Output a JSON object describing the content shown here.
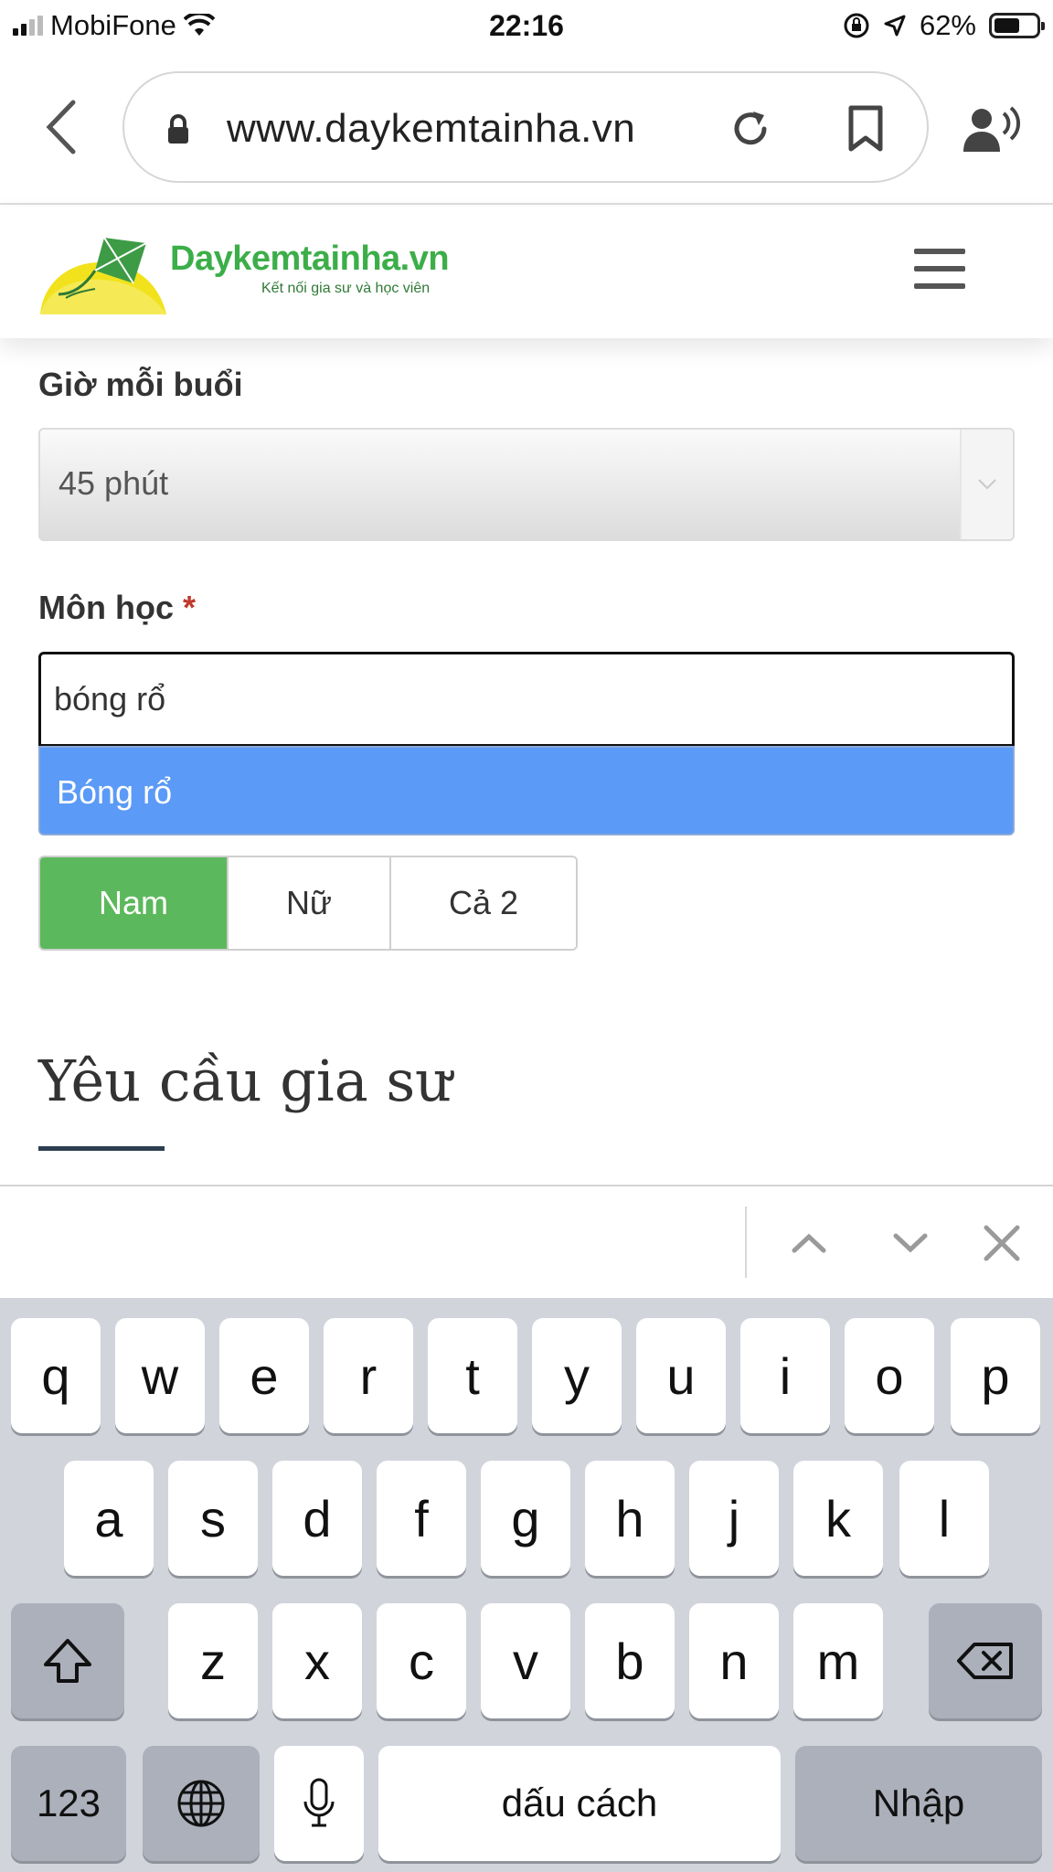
{
  "status_bar": {
    "carrier": "MobiFone",
    "time": "22:16",
    "battery": "62%",
    "battery_level": 0.62
  },
  "browser": {
    "url": "www.daykemtainha.vn"
  },
  "site": {
    "logo_name": "Daykemtainha.vn",
    "logo_tagline": "Kết nối gia sư và học viên"
  },
  "form": {
    "duration_label": "Giờ mỗi buổi",
    "duration_value": "45 phút",
    "subject_label": "Môn học",
    "subject_required_mark": "*",
    "subject_value": "bóng rổ",
    "subject_suggestion": "Bóng rổ",
    "gender_options": [
      "Nam",
      "Nữ",
      "Cả 2"
    ],
    "gender_selected": "Nam"
  },
  "section": {
    "title": "Yêu cầu gia sư"
  },
  "keyboard": {
    "row1": [
      "q",
      "w",
      "e",
      "r",
      "t",
      "y",
      "u",
      "i",
      "o",
      "p"
    ],
    "row2": [
      "a",
      "s",
      "d",
      "f",
      "g",
      "h",
      "j",
      "k",
      "l"
    ],
    "row3": [
      "z",
      "x",
      "c",
      "v",
      "b",
      "n",
      "m"
    ],
    "numbers_label": "123",
    "space_label": "dấu cách",
    "return_label": "Nhập"
  },
  "colors": {
    "brand_green": "#3cae49",
    "selected_green": "#5cb85c",
    "suggestion_blue": "#5b9af6",
    "required_red": "#c0392b",
    "keyboard_bg": "#d1d4db"
  }
}
